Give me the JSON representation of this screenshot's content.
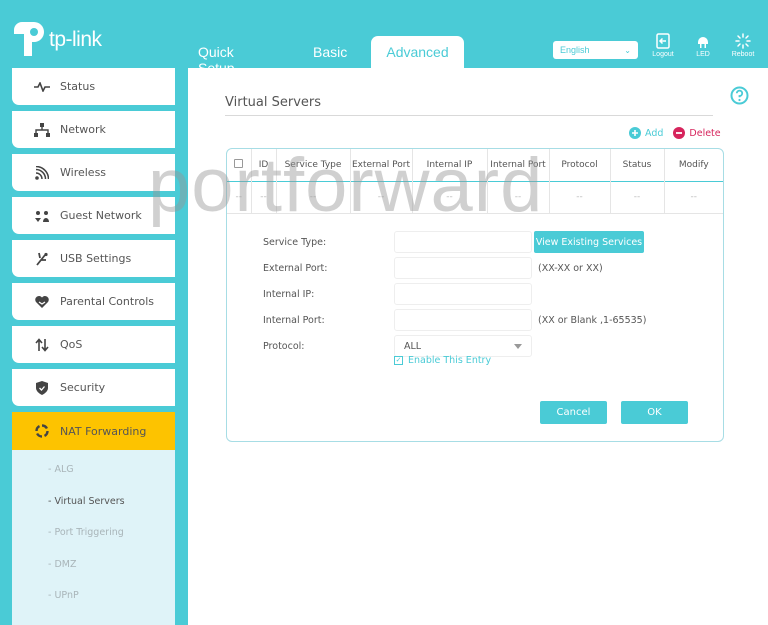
{
  "brand": {
    "logo_text": "tp-link"
  },
  "header": {
    "tabs": [
      {
        "label": "Quick Setup"
      },
      {
        "label": "Basic"
      },
      {
        "label": "Advanced",
        "active": true
      }
    ],
    "language": {
      "selected": "English"
    },
    "tools": [
      {
        "label": "Logout",
        "icon": "logout-icon"
      },
      {
        "label": "LED",
        "icon": "led-icon"
      },
      {
        "label": "Reboot",
        "icon": "reboot-icon"
      }
    ]
  },
  "sidebar": {
    "items": [
      {
        "label": "Status",
        "icon": "pulse-icon"
      },
      {
        "label": "Network",
        "icon": "network-icon"
      },
      {
        "label": "Wireless",
        "icon": "wifi-icon"
      },
      {
        "label": "Guest Network",
        "icon": "guest-icon"
      },
      {
        "label": "USB Settings",
        "icon": "usb-icon"
      },
      {
        "label": "Parental Controls",
        "icon": "heart-icon"
      },
      {
        "label": "QoS",
        "icon": "updown-arrows-icon"
      },
      {
        "label": "Security",
        "icon": "shield-icon"
      },
      {
        "label": "NAT Forwarding",
        "icon": "nat-icon",
        "active": true
      }
    ],
    "subitems": [
      {
        "label": "- ALG"
      },
      {
        "label": "- Virtual Servers",
        "current": true
      },
      {
        "label": "- Port Triggering"
      },
      {
        "label": "- DMZ"
      },
      {
        "label": "- UPnP"
      }
    ]
  },
  "main": {
    "title": "Virtual Servers",
    "actions": {
      "add": "Add",
      "delete": "Delete"
    },
    "table": {
      "columns": [
        "",
        "ID",
        "Service Type",
        "External Port",
        "Internal IP",
        "Internal Port",
        "Protocol",
        "Status",
        "Modify"
      ],
      "rows": [
        [
          "--",
          "--",
          "--",
          "--",
          "--",
          "--",
          "--",
          "--",
          "--"
        ]
      ]
    },
    "form": {
      "service_type": {
        "label": "Service Type:",
        "value": ""
      },
      "view_button": "View Existing Services",
      "external_port": {
        "label": "External Port:",
        "value": "",
        "hint": "(XX-XX or XX)"
      },
      "internal_ip": {
        "label": "Internal IP:",
        "value": ""
      },
      "internal_port": {
        "label": "Internal Port:",
        "value": "",
        "hint": "(XX or Blank ,1-65535)"
      },
      "protocol": {
        "label": "Protocol:",
        "value": "ALL"
      },
      "enable": {
        "label": "Enable This Entry",
        "checked": true
      },
      "cancel": "Cancel",
      "ok": "OK"
    }
  },
  "watermark": "portforward",
  "colors": {
    "accent": "#4acbd6",
    "active_nav": "#fdc300",
    "delete": "#d6245c",
    "subnav_bg": "#dff3f8"
  }
}
